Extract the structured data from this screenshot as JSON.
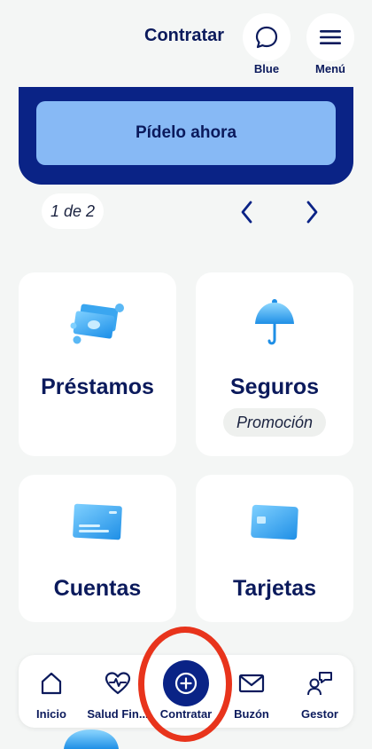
{
  "header": {
    "title": "Contratar",
    "chat_label": "Blue",
    "menu_label": "Menú"
  },
  "banner": {
    "cta_label": "Pídelo ahora"
  },
  "pager": {
    "count_text": "1 de 2"
  },
  "products": [
    {
      "title": "Préstamos",
      "icon": "money-bills-icon"
    },
    {
      "title": "Seguros",
      "badge": "Promoción",
      "icon": "umbrella-icon"
    },
    {
      "title": "Cuentas",
      "icon": "account-card-icon"
    },
    {
      "title": "Tarjetas",
      "icon": "credit-card-icon"
    }
  ],
  "bottom_nav": [
    {
      "label": "Inicio",
      "icon": "home-icon"
    },
    {
      "label": "Salud Fin...",
      "icon": "heart-pulse-icon"
    },
    {
      "label": "Contratar",
      "icon": "plus-circle-icon",
      "selected": true
    },
    {
      "label": "Buzón",
      "icon": "mail-icon"
    },
    {
      "label": "Gestor",
      "icon": "manager-chat-icon"
    }
  ],
  "colors": {
    "brand_navy": "#0a2386",
    "text_navy": "#0b1a5c",
    "cta_blue": "#87b9f5",
    "background": "#f4f6f5",
    "highlight_red": "#e8341c"
  }
}
